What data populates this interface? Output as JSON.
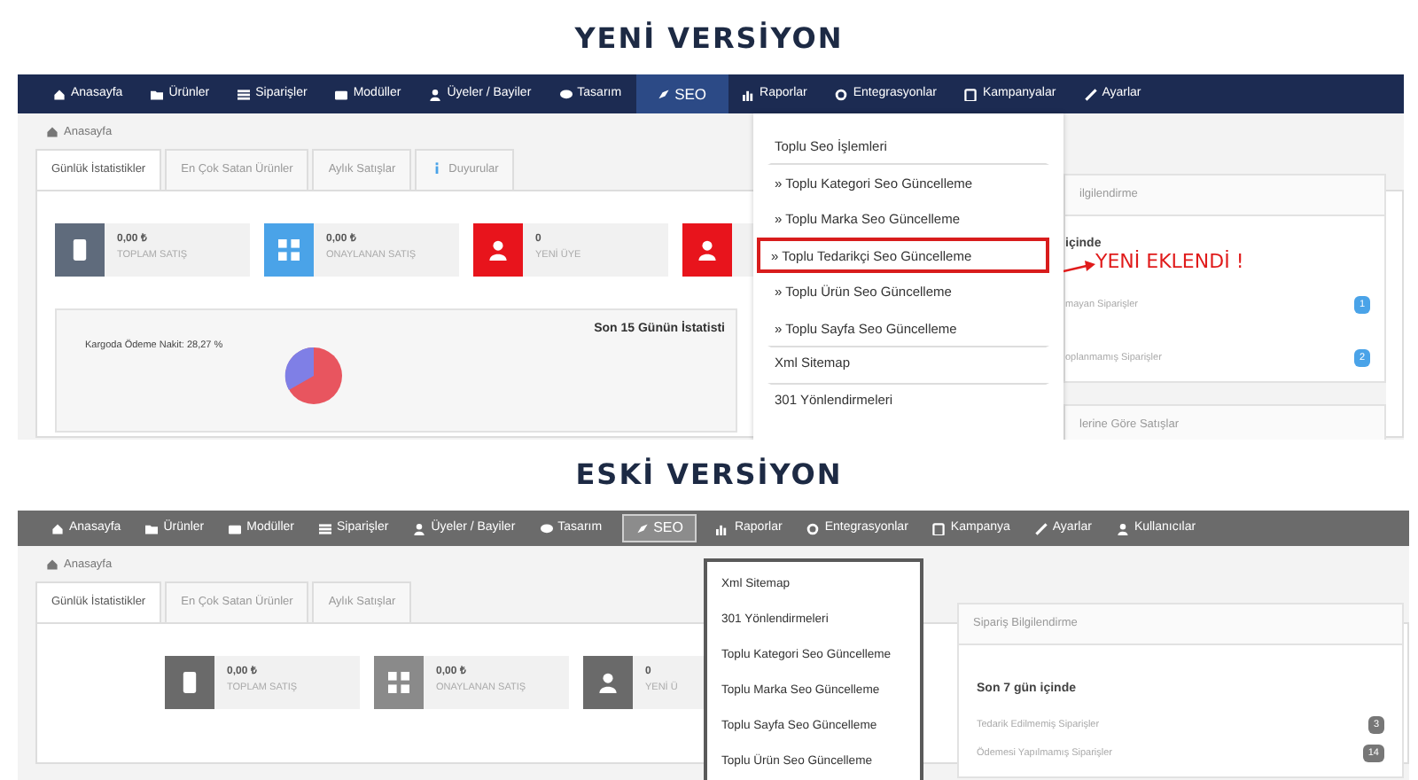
{
  "new_version": {
    "heading": "YENİ VERSİYON",
    "navbar": [
      {
        "label": "Anasayfa",
        "selected": false
      },
      {
        "label": "Ürünler",
        "selected": false
      },
      {
        "label": "Siparişler",
        "selected": false
      },
      {
        "label": "Modüller",
        "selected": false
      },
      {
        "label": "Üyeler / Bayiler",
        "selected": false
      },
      {
        "label": "Tasarım",
        "selected": false
      },
      {
        "label": "SEO",
        "selected": true
      },
      {
        "label": "Raporlar",
        "selected": false
      },
      {
        "label": "Entegrasyonlar",
        "selected": false
      },
      {
        "label": "Kampanyalar",
        "selected": false
      },
      {
        "label": "Ayarlar",
        "selected": false
      }
    ],
    "breadcrumb": "Anasayfa",
    "tabs": [
      {
        "label": "Günlük İstatistikler",
        "selected": true
      },
      {
        "label": "En Çok Satan Ürünler",
        "selected": false
      },
      {
        "label": "Aylık Satışlar",
        "selected": false
      },
      {
        "label": "Duyurular",
        "selected": false
      }
    ],
    "stats": [
      {
        "value": "0,00 ₺",
        "label": "TOPLAM SATIŞ",
        "color": "#5f6b7c"
      },
      {
        "value": "0,00 ₺",
        "label": "ONAYLANAN SATIŞ",
        "color": "#4aa3e8"
      },
      {
        "value": "0",
        "label": "YENİ ÜYE",
        "color": "#e8141c"
      },
      {
        "color": "#e8141c"
      }
    ],
    "chart": {
      "title": "Son 15 Günün İstatisti",
      "slice_label": "Kargoda Ödeme Nakit: 28,27 %"
    },
    "dropdown": [
      {
        "label": "Toplu Seo İşlemleri",
        "kind": "header",
        "highlighted": false
      },
      {
        "label": "» Toplu Kategori Seo Güncelleme",
        "kind": "sub",
        "highlighted": false
      },
      {
        "label": "» Toplu Marka Seo Güncelleme",
        "kind": "sub",
        "highlighted": false
      },
      {
        "label": "» Toplu Tedarikçi Seo Güncelleme",
        "kind": "sub",
        "highlighted": true
      },
      {
        "label": "» Toplu Ürün Seo Güncelleme",
        "kind": "sub",
        "highlighted": false
      },
      {
        "label": "» Toplu Sayfa Seo Güncelleme",
        "kind": "sub",
        "highlighted": false
      },
      {
        "label": "Xml Sitemap",
        "kind": "link",
        "highlighted": false
      },
      {
        "label": "301 Yönlendirmeleri",
        "kind": "link",
        "highlighted": false
      }
    ],
    "annotation": "YENİ EKLENDİ !",
    "side_panel": {
      "header": "ilgilendirme",
      "subtitle": "içinde",
      "items": [
        {
          "label": "mayan Siparişler",
          "count": "1"
        },
        {
          "label": "oplanmamış Siparişler",
          "count": "2"
        }
      ],
      "footer_header": "lerine Göre Satışlar"
    }
  },
  "old_version": {
    "heading": "ESKİ VERSİYON",
    "navbar": [
      {
        "label": "Anasayfa",
        "selected": false
      },
      {
        "label": "Ürünler",
        "selected": false
      },
      {
        "label": "Modüller",
        "selected": false
      },
      {
        "label": "Siparişler",
        "selected": false
      },
      {
        "label": "Üyeler / Bayiler",
        "selected": false
      },
      {
        "label": "Tasarım",
        "selected": false
      },
      {
        "label": "SEO",
        "selected": true
      },
      {
        "label": "Raporlar",
        "selected": false
      },
      {
        "label": "Entegrasyonlar",
        "selected": false
      },
      {
        "label": "Kampanya",
        "selected": false
      },
      {
        "label": "Ayarlar",
        "selected": false
      },
      {
        "label": "Kullanıcılar",
        "selected": false
      }
    ],
    "breadcrumb": "Anasayfa",
    "tabs": [
      {
        "label": "Günlük İstatistikler",
        "selected": true
      },
      {
        "label": "En Çok Satan Ürünler",
        "selected": false
      },
      {
        "label": "Aylık Satışlar",
        "selected": false
      }
    ],
    "stats": [
      {
        "value": "0,00 ₺",
        "label": "TOPLAM SATIŞ",
        "color": "#6a6a6a"
      },
      {
        "value": "0,00 ₺",
        "label": "ONAYLANAN SATIŞ",
        "color": "#8a8a8a"
      },
      {
        "value": "0",
        "label": "YENİ Ü",
        "color": "#6a6a6a"
      }
    ],
    "dropdown": [
      {
        "label": "Xml Sitemap"
      },
      {
        "label": "301 Yönlendirmeleri"
      },
      {
        "label": "Toplu Kategori Seo Güncelleme"
      },
      {
        "label": "Toplu Marka Seo Güncelleme"
      },
      {
        "label": "Toplu Sayfa Seo Güncelleme"
      },
      {
        "label": "Toplu Ürün Seo Güncelleme"
      }
    ],
    "side_panel": {
      "header": "Sipariş Bilgilendirme",
      "subtitle": "Son 7 gün içinde",
      "items": [
        {
          "label": "Tedarik Edilmemiş Siparişler",
          "count": "3"
        },
        {
          "label": "Ödemesi Yapılmamış Siparişler",
          "count": "14"
        }
      ]
    }
  }
}
